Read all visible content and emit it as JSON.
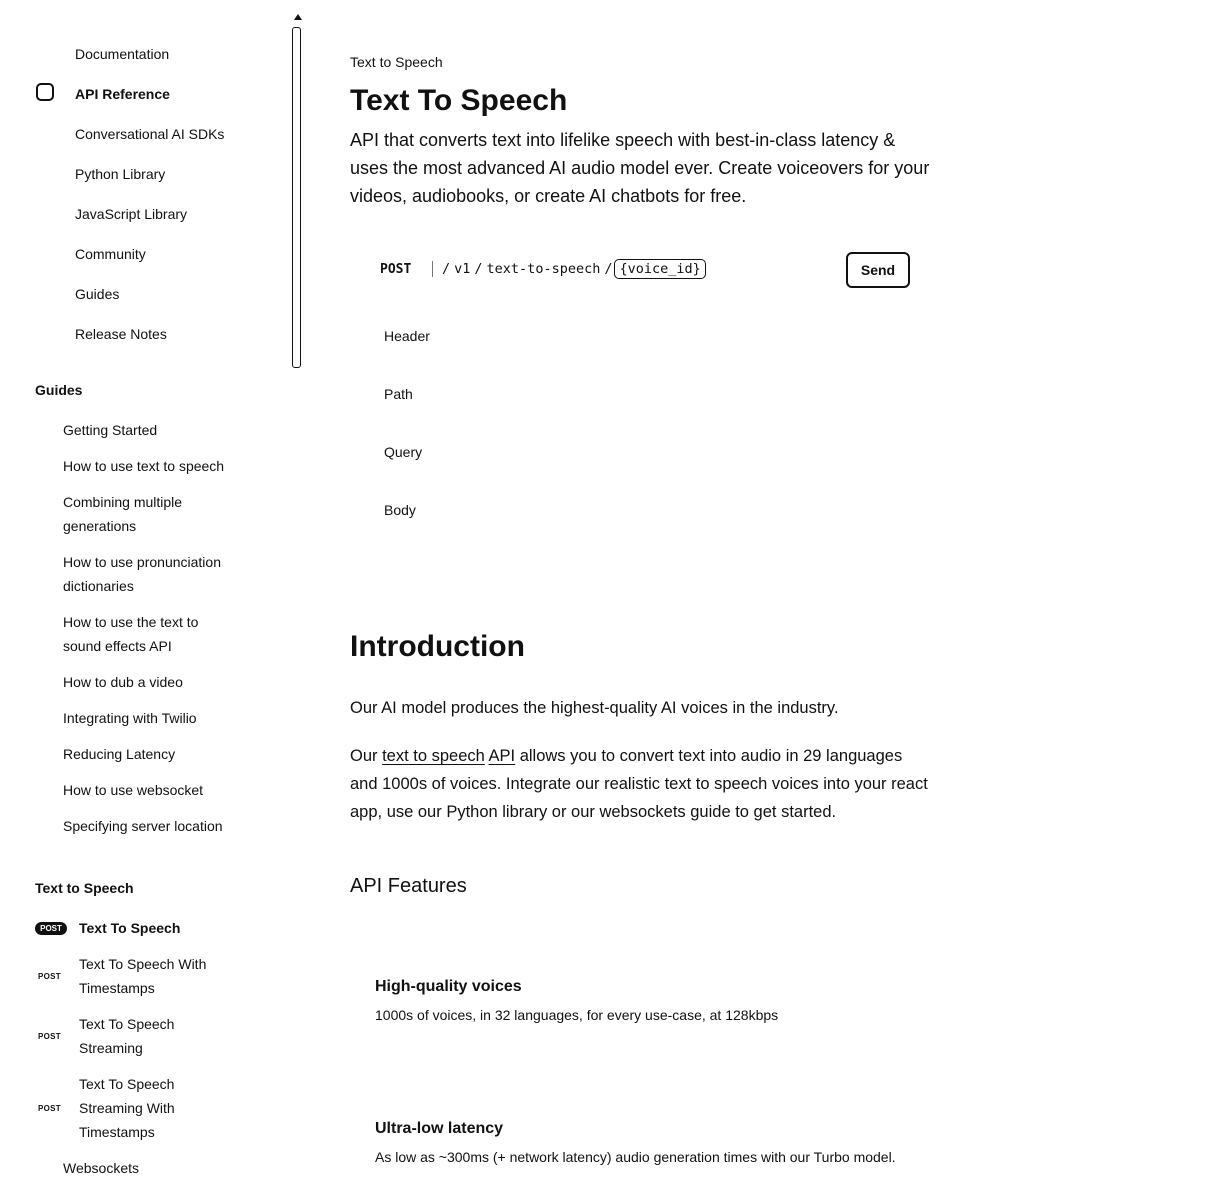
{
  "sidebar": {
    "top_nav": [
      "Documentation",
      "API Reference",
      "Conversational AI SDKs",
      "Python Library",
      "JavaScript Library",
      "Community",
      "Guides",
      "Release Notes"
    ],
    "guides_heading": "Guides",
    "guides": [
      "Getting Started",
      "How to use text to speech",
      "Combining multiple generations",
      "How to use pronunciation dictionaries",
      "How to use the text to sound effects API",
      "How to dub a video",
      "Integrating with Twilio",
      "Reducing Latency",
      "How to use websocket",
      "Specifying server location"
    ],
    "tts_heading": "Text to Speech",
    "tts_items": [
      {
        "method": "POST",
        "label": "Text To Speech"
      },
      {
        "method": "POST",
        "label": "Text To Speech With Timestamps"
      },
      {
        "method": "POST",
        "label": "Text To Speech Streaming"
      },
      {
        "method": "POST",
        "label": "Text To Speech Streaming With Timestamps"
      }
    ],
    "websockets_label": "Websockets"
  },
  "main": {
    "breadcrumb": "Text to Speech",
    "title": "Text To Speech",
    "description": "API that converts text into lifelike speech with best-in-class latency & uses the most advanced AI audio model ever. Create voiceovers for your videos, audiobooks, or create AI chatbots for free.",
    "endpoint": {
      "method": "POST",
      "segments": [
        "/",
        "v1",
        "/",
        "text-to-speech",
        "/"
      ],
      "param": "{voice_id}",
      "send_label": "Send"
    },
    "param_sections": [
      "Header",
      "Path",
      "Query",
      "Body"
    ],
    "intro_title": "Introduction",
    "intro_p1": "Our AI model produces the highest-quality AI voices in the industry.",
    "intro_p2": {
      "pre": "Our ",
      "link1": "text to speech",
      "mid": " ",
      "link2": "API",
      "post": " allows you to convert text into audio in 29 languages and 1000s of voices. Integrate our realistic text to speech voices into your react app, use our Python library or our websockets guide to get started."
    },
    "features_title": "API Features",
    "features": [
      {
        "title": "High-quality voices",
        "desc": "1000s of voices, in 32 languages, for every use-case, at 128kbps"
      },
      {
        "title": "Ultra-low latency",
        "desc": "As low as ~300ms (+ network latency) audio generation times with our Turbo model."
      }
    ]
  }
}
